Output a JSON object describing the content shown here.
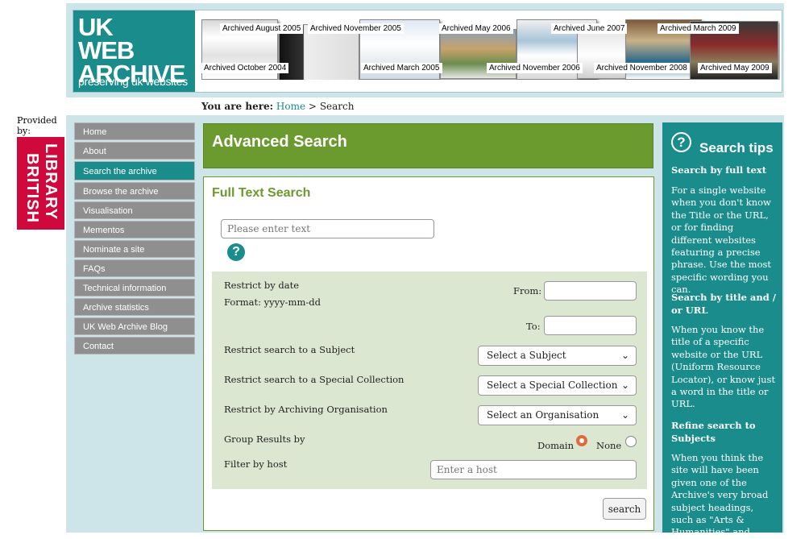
{
  "header": {
    "logo_line1": "UK",
    "logo_line2": "WEB",
    "logo_line3": "ARCHIVE",
    "logo_tagline": "preserving uk websites",
    "archive_labels": [
      "Archived August 2005",
      "Archived November 2005",
      "Archived May 2006",
      "Archived June 2007",
      "Archived March 2009",
      "Archived October 2004",
      "Archived March 2005",
      "Archived November 2006",
      "Archived November 2008",
      "Archived May 2009"
    ]
  },
  "provider": {
    "label": "Provided by:",
    "logo_line1": "BRITISH",
    "logo_line2": "LIBRARY"
  },
  "breadcrumb": {
    "prefix": "You are here:",
    "home": "Home",
    "separator": ">",
    "current": "Search"
  },
  "nav": {
    "items": [
      "Home",
      "About",
      "Search the archive",
      "Browse the archive",
      "Visualisation",
      "Mementos",
      "Nominate a site",
      "FAQs",
      "Technical information",
      "Archive statistics",
      "UK Web Archive Blog",
      "Contact"
    ],
    "active": "Search the archive"
  },
  "main": {
    "title": "Advanced Search",
    "full_text_heading": "Full Text Search",
    "text_placeholder": "Please enter text",
    "help_glyph": "?",
    "date_label": "Restrict by date",
    "date_format": "Format: yyyy-mm-dd",
    "from_label": "From:",
    "to_label": "To:",
    "subject_label": "Restrict search to a Subject",
    "subject_select": "Select a Subject",
    "collection_label": "Restrict search to a Special Collection",
    "collection_select": "Select a Special Collection",
    "org_label": "Restrict by Archiving Organisation",
    "org_select": "Select an Organisation",
    "group_label": "Group Results by",
    "group_options": [
      "Domain",
      "None"
    ],
    "group_selected": "Domain",
    "host_label": "Filter by host",
    "host_placeholder": "Enter a host",
    "search_button": "search"
  },
  "tips": {
    "icon_glyph": "?",
    "title": "Search tips",
    "sections": [
      {
        "heading": "Search by full text",
        "body": "For a single website when you don't know the Title or the URL, or for finding different websites featuring a precise phrase. Use the most specific wording you can."
      },
      {
        "heading": "Search by title and / or URL",
        "body": "When you know the title of a specific website or the URL (Uniform Resource Locator), or know just a word in the title or URL."
      },
      {
        "heading": "Refine search to Subjects",
        "body": "When you think the site will have been given one of the Archive's very broad subject headings, such as \"Arts & Humanities\" and"
      }
    ]
  },
  "colors": {
    "teal": "#1a8c8c",
    "green": "#6b9a2e",
    "nav_grey": "#8f8f8f",
    "frame": "#cde4e8",
    "bl_red": "#d0093c"
  }
}
